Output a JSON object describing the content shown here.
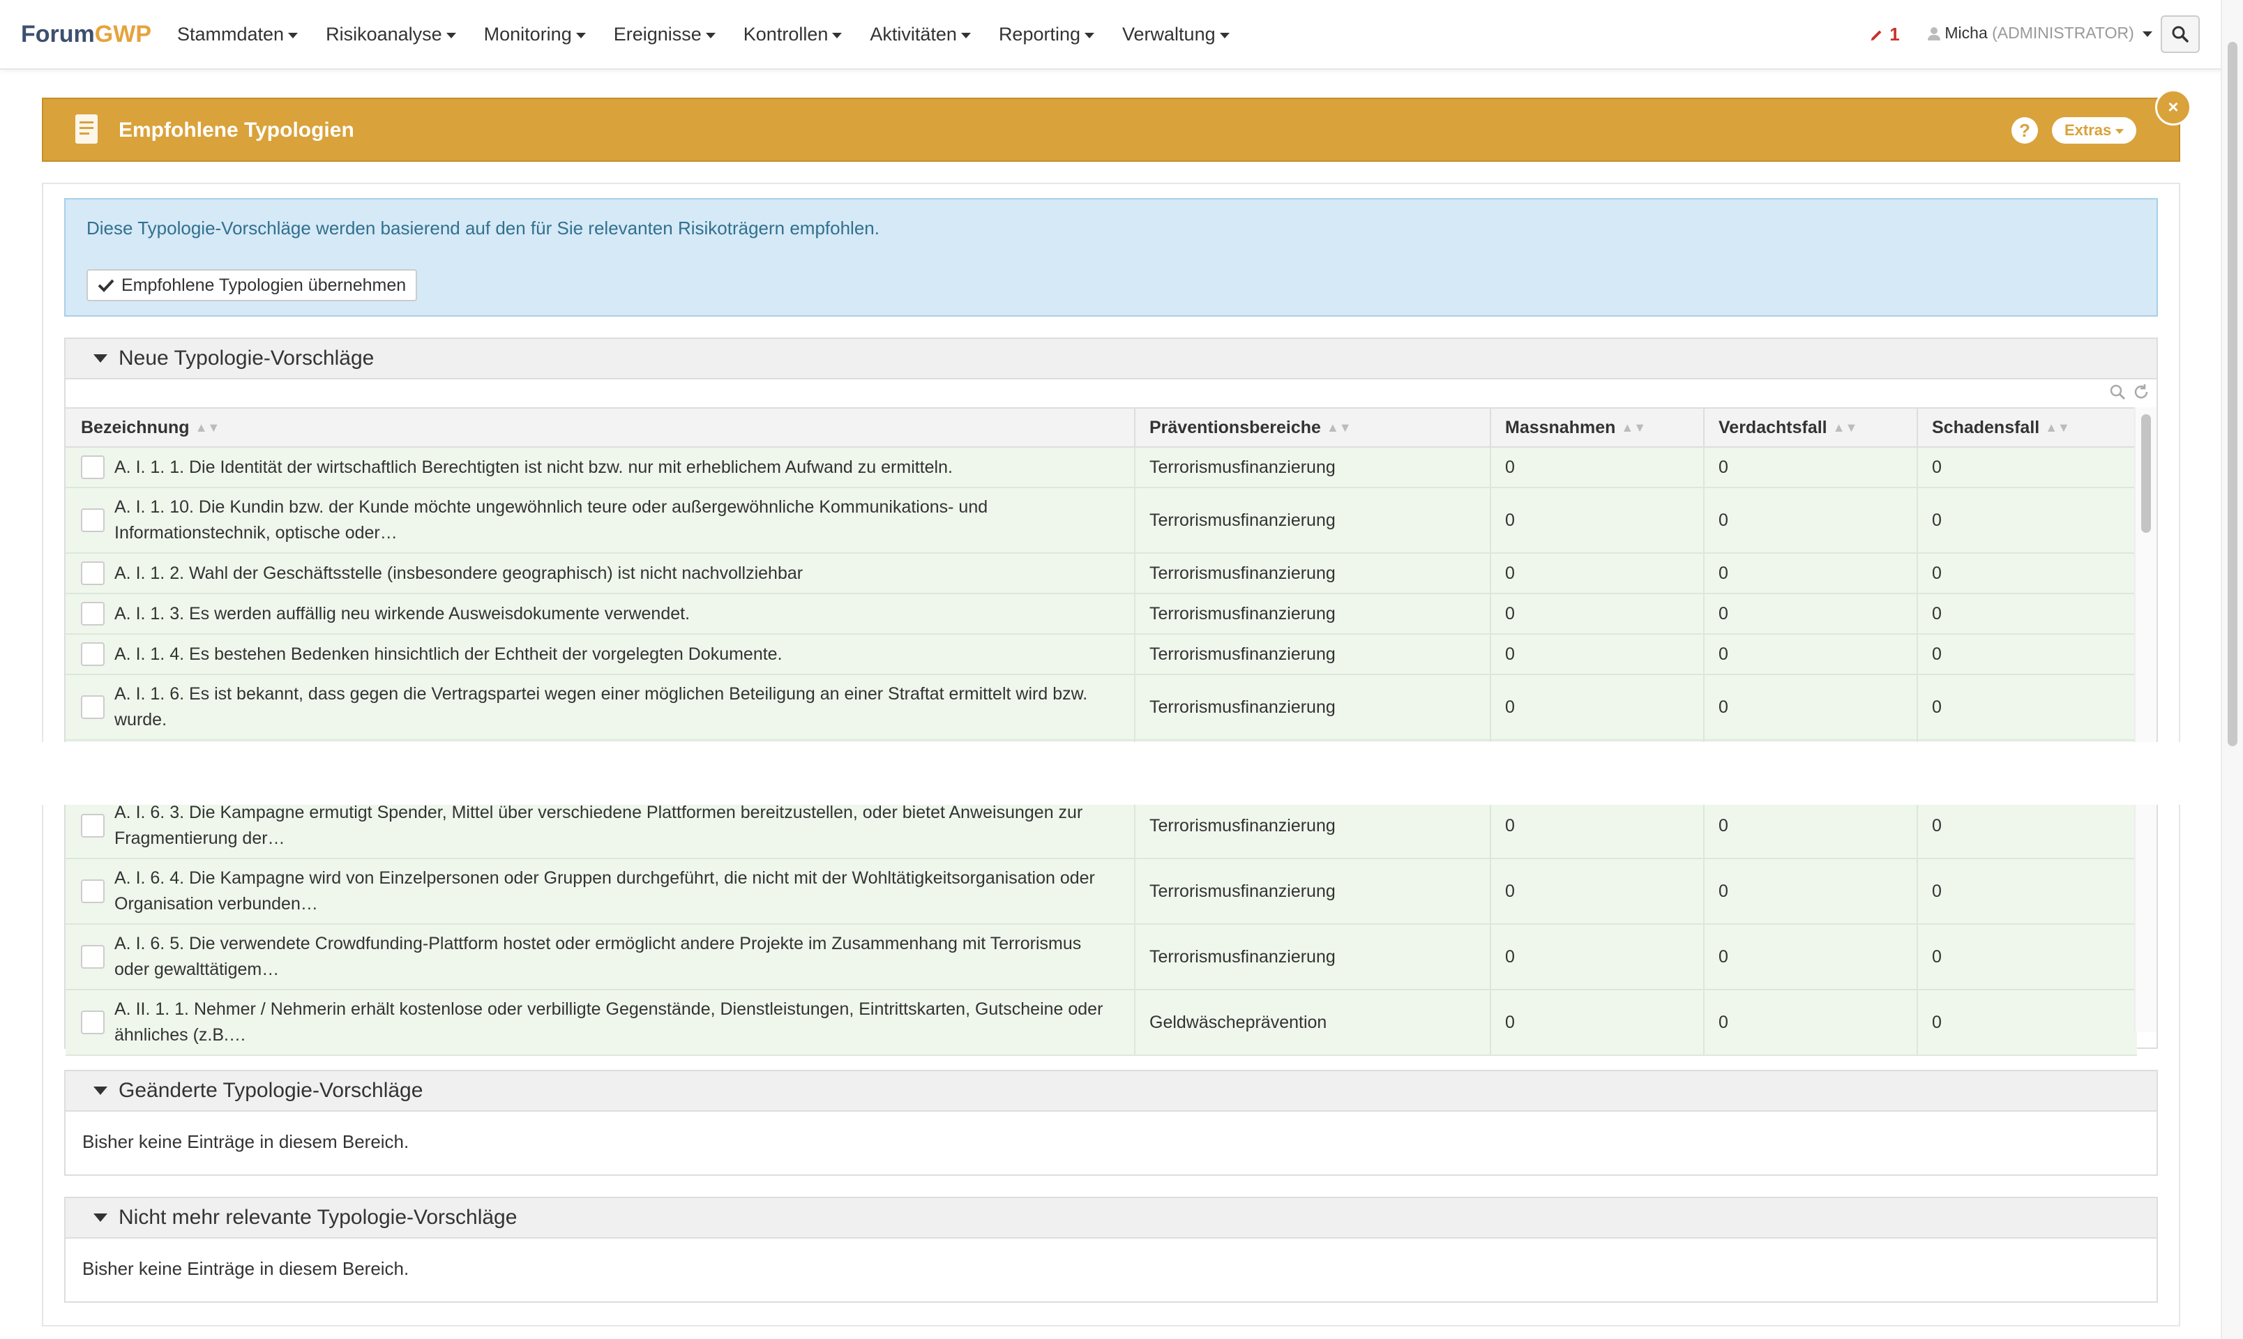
{
  "nav": {
    "brand_part1": "Forum",
    "brand_part2": "GWP",
    "menu": [
      "Stammdaten",
      "Risikoanalyse",
      "Monitoring",
      "Ereignisse",
      "Kontrollen",
      "Aktivitäten",
      "Reporting",
      "Verwaltung"
    ],
    "notification_count": "1",
    "user_name": "Micha",
    "user_role": "(ADMINISTRATOR)"
  },
  "panel": {
    "title": "Empfohlene Typologien",
    "help_label": "?",
    "extras_label": "Extras",
    "close_label": "×"
  },
  "alert": {
    "message": "Diese Typologie-Vorschläge werden basierend auf den für Sie relevanten Risikoträgern empfohlen.",
    "button_label": "Empfohlene Typologien übernehmen"
  },
  "sections": {
    "new_title": "Neue Typologie-Vorschläge",
    "changed_title": "Geänderte Typologie-Vorschläge",
    "obsolete_title": "Nicht mehr relevante Typologie-Vorschläge",
    "empty_text": "Bisher keine Einträge in diesem Bereich."
  },
  "table": {
    "columns": [
      "Bezeichnung",
      "Präventionsbereiche",
      "Massnahmen",
      "Verdachtsfall",
      "Schadensfall"
    ],
    "rows": [
      {
        "name": "A. I. 1. 1. Die Identität der wirtschaftlich Berechtigten ist nicht bzw. nur mit erheblichem Aufwand zu ermitteln.",
        "area": "Terrorismusfinanzierung",
        "m": "0",
        "v": "0",
        "s": "0"
      },
      {
        "name": "A. I. 1. 10. Die Kundin bzw. der Kunde möchte ungewöhnlich teure oder außergewöhnliche Kommunikations- und Informationstechnik, optische oder…",
        "area": "Terrorismusfinanzierung",
        "m": "0",
        "v": "0",
        "s": "0"
      },
      {
        "name": "A. I. 1. 2. Wahl der Geschäftsstelle (insbesondere geographisch) ist nicht nachvollziehbar",
        "area": "Terrorismusfinanzierung",
        "m": "0",
        "v": "0",
        "s": "0"
      },
      {
        "name": "A. I. 1. 3. Es werden auffällig neu wirkende Ausweisdokumente verwendet.",
        "area": "Terrorismusfinanzierung",
        "m": "0",
        "v": "0",
        "s": "0"
      },
      {
        "name": "A. I. 1. 4. Es bestehen Bedenken hinsichtlich der Echtheit der vorgelegten Dokumente.",
        "area": "Terrorismusfinanzierung",
        "m": "0",
        "v": "0",
        "s": "0"
      },
      {
        "name": "A. I. 1. 6. Es ist bekannt, dass gegen die Vertragspartei wegen einer möglichen Beteiligung an einer Straftat ermittelt wird bzw. wurde.",
        "area": "Terrorismusfinanzierung",
        "m": "0",
        "v": "0",
        "s": "0"
      },
      {
        "name": "A. I. 6. 3. Die Kampagne ermutigt Spender, Mittel über verschiedene Plattformen bereitzustellen, oder bietet Anweisungen zur Fragmentierung der…",
        "area": "Terrorismusfinanzierung",
        "m": "0",
        "v": "0",
        "s": "0"
      },
      {
        "name": "A. I. 6. 4. Die Kampagne wird von Einzelpersonen oder Gruppen durchgeführt, die nicht mit der Wohltätigkeitsorganisation oder Organisation verbunden…",
        "area": "Terrorismusfinanzierung",
        "m": "0",
        "v": "0",
        "s": "0"
      },
      {
        "name": "A. I. 6. 5. Die verwendete Crowdfunding-Plattform hostet oder ermöglicht andere Projekte im Zusammenhang mit Terrorismus oder gewalttätigem…",
        "area": "Terrorismusfinanzierung",
        "m": "0",
        "v": "0",
        "s": "0"
      },
      {
        "name": "A. II. 1. 1. Nehmer / Nehmerin erhält kostenlose oder verbilligte Gegenstände, Dienstleistungen, Eintrittskarten, Gutscheine oder ähnliches (z.B.…",
        "area": "Geldwäscheprävention",
        "m": "0",
        "v": "0",
        "s": "0"
      }
    ]
  }
}
